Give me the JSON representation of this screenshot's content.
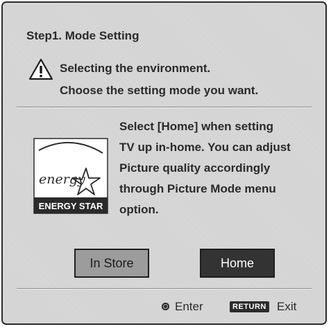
{
  "dialog": {
    "title": "Step1.  Mode Setting",
    "warning": {
      "icon": "warning-triangle-icon",
      "line1": "Selecting the environment.",
      "line2": "Choose the setting mode you want."
    },
    "logo": {
      "icon": "energy-star-logo",
      "script_text": "energy",
      "label": "ENERGY STAR"
    },
    "description": [
      "Select [Home] when setting",
      "TV up in-home. You can adjust",
      "Picture quality accordingly",
      "through Picture Mode menu",
      "option."
    ],
    "buttons": {
      "in_store": "In Store",
      "home": "Home",
      "selected": "home"
    },
    "footer": {
      "enter_icon": "enter-dot-icon",
      "enter_label": "Enter",
      "return_key": "RETURN",
      "exit_label": "Exit"
    }
  },
  "colors": {
    "panel_background": "#d8d8d8",
    "border": "#2b2b2b",
    "text": "#2a2a2a",
    "selected_button": "#333333",
    "unselected_button": "#9c9c9c"
  }
}
